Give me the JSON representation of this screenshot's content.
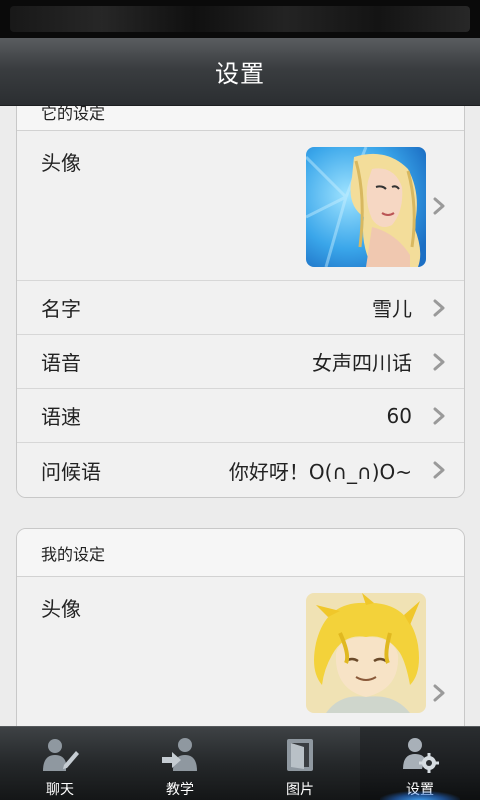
{
  "header": {
    "title": "设置"
  },
  "robot_settings": {
    "section_title": "它的设定",
    "rows": [
      {
        "label": "头像",
        "value": ""
      },
      {
        "label": "名字",
        "value": "雪儿"
      },
      {
        "label": "语音",
        "value": "女声四川话"
      },
      {
        "label": "语速",
        "value": "60"
      },
      {
        "label": "问候语",
        "value": "你好呀！O(∩_∩)O~"
      }
    ]
  },
  "my_settings": {
    "section_title": "我的设定",
    "rows": [
      {
        "label": "头像",
        "value": ""
      }
    ]
  },
  "tabs": [
    {
      "label": "聊天",
      "icon": "chat-icon",
      "active": false
    },
    {
      "label": "教学",
      "icon": "teach-icon",
      "active": false
    },
    {
      "label": "图片",
      "icon": "picture-icon",
      "active": false
    },
    {
      "label": "设置",
      "icon": "settings-icon",
      "active": true
    }
  ],
  "colors": {
    "title_bar": "#3a3d40",
    "card_bg": "#f1f1f1",
    "active_tab_glow": "#46aaff"
  }
}
